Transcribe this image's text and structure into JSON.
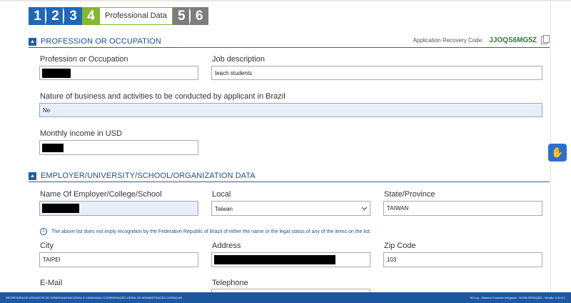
{
  "wizard": {
    "steps": [
      {
        "number": "1",
        "state": "done"
      },
      {
        "number": "2",
        "state": "done"
      },
      {
        "number": "3",
        "state": "done"
      },
      {
        "number": "4",
        "state": "active"
      },
      {
        "number": "5",
        "state": "future"
      },
      {
        "number": "6",
        "state": "future"
      }
    ],
    "active_label": "Professional Data"
  },
  "recovery": {
    "label": "Application Recovery Code:",
    "code": "JJOQS6MG5Z"
  },
  "profession_section": {
    "toggle_icon": "chevron-up-icon",
    "title": "PROFESSION OR OCCUPATION",
    "profession_label": "Profession or Occupation",
    "profession_value": "",
    "job_description_label": "Job description",
    "job_description_value": "teach students",
    "nature_label": "Nature of business and activities to be conducted by applicant in Brazil",
    "nature_value": "No",
    "income_label": "Monthly income in USD",
    "income_value": ""
  },
  "employer_section": {
    "toggle_icon": "chevron-up-icon",
    "title": "EMPLOYER/UNIVERSITY/SCHOOL/ORGANIZATION DATA",
    "employer_name_label": "Name Of Employer/College/School",
    "employer_name_value": "",
    "local_label": "Local",
    "local_value": "Taiwan",
    "state_label": "State/Province",
    "state_value": "TAIWAN",
    "info_text": "The above list does not imply recognition by the Federative Republic of Brazil of either the name or the legal status of any of the items on the list.",
    "city_label": "City",
    "city_value": "TAIPEI",
    "address_label": "Address",
    "address_value": "",
    "zip_label": "Zip Code",
    "zip_value": "103",
    "email_label": "E-Mail",
    "telephone_label": "Telephone"
  },
  "footer": {
    "left_text": "SECRETARIA DE ASSUNTOS DE SOBERANIA NACIONAL E CIDADANIA | COORDENAÇÃO-GERAL DE ADMINISTRAÇÃO CONSULAR",
    "right_text": "SCI.ng - Sistema Consular Integrado - NOVA GERAÇÃO - Versão: 3.24.8.1"
  },
  "accessibility_button": {
    "icon": "hand-sign-icon"
  },
  "colors": {
    "primary": "#1f67b8",
    "active_step": "#84b82f",
    "future_step": "#7d7d7d",
    "footer": "#1b57a3",
    "code": "#2b7d2b"
  }
}
